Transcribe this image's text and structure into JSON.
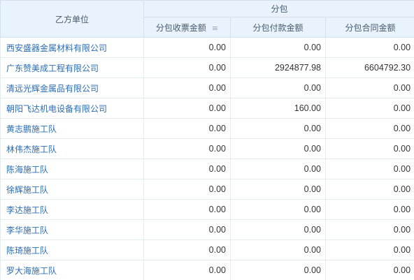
{
  "header": {
    "party_label": "乙方单位",
    "group_label": "分包",
    "col_invoice": "分包收票金额",
    "col_payment": "分包付款金额",
    "col_contract": "分包合同金额",
    "sort_icon": "sort-desc-icon"
  },
  "rows": [
    {
      "name": "西安盛器金属材料有限公司",
      "invoice": "0.00",
      "payment": "0.00",
      "contract": "0.00"
    },
    {
      "name": "广东赞美成工程有限公司",
      "invoice": "0.00",
      "payment": "2924877.98",
      "contract": "6604792.30"
    },
    {
      "name": "清远光辉金属品有限公司",
      "invoice": "0.00",
      "payment": "0.00",
      "contract": "0.00"
    },
    {
      "name": "朝阳飞达机电设备有限公司",
      "invoice": "0.00",
      "payment": "160.00",
      "contract": "0.00"
    },
    {
      "name": "黄志鹏施工队",
      "invoice": "0.00",
      "payment": "0.00",
      "contract": "0.00"
    },
    {
      "name": "林伟杰施工队",
      "invoice": "0.00",
      "payment": "0.00",
      "contract": "0.00"
    },
    {
      "name": "陈海施工队",
      "invoice": "0.00",
      "payment": "0.00",
      "contract": "0.00"
    },
    {
      "name": "徐辉施工队",
      "invoice": "0.00",
      "payment": "0.00",
      "contract": "0.00"
    },
    {
      "name": "李达施工队",
      "invoice": "0.00",
      "payment": "0.00",
      "contract": "0.00"
    },
    {
      "name": "李华施工队",
      "invoice": "0.00",
      "payment": "0.00",
      "contract": "0.00"
    },
    {
      "name": "陈琦施工队",
      "invoice": "0.00",
      "payment": "0.00",
      "contract": "0.00"
    },
    {
      "name": "罗大海施工队",
      "invoice": "0.00",
      "payment": "0.00",
      "contract": "0.00"
    }
  ]
}
